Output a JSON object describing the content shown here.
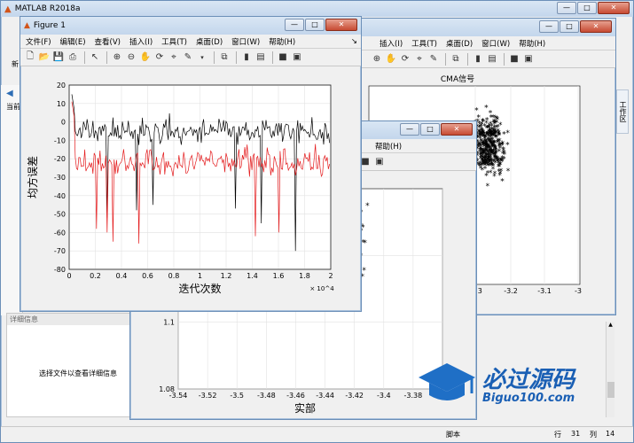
{
  "app": {
    "title": "MATLAB R2018a",
    "toolstrip_new": "新",
    "left_label_current": "当前",
    "right_tab_label": "工作区",
    "detail_header": "详细信息",
    "detail_placeholder": "选择文件以查看详细信息",
    "status_script": "脚本",
    "status_row_label": "行",
    "status_row": "31",
    "status_col_label": "列",
    "status_col": "14"
  },
  "figure1": {
    "title": "Figure 1",
    "menu": [
      "文件(F)",
      "编辑(E)",
      "查看(V)",
      "插入(I)",
      "工具(T)",
      "桌面(D)",
      "窗口(W)",
      "帮助(H)"
    ],
    "controls": {
      "min": "—",
      "max": "□",
      "close": "✕"
    }
  },
  "figure_cma": {
    "menu": [
      "插入(I)",
      "工具(T)",
      "桌面(D)",
      "窗口(W)",
      "帮助(H)"
    ]
  },
  "figure_mid": {
    "menu_help": "帮助(H)"
  },
  "watermark": {
    "name": "必过源码",
    "url": "Biguo100.com"
  },
  "colors": {
    "series_black": "#000000",
    "series_red": "#e41a1c",
    "title_bg": "#c3d6ec"
  },
  "chart_data": [
    {
      "type": "line",
      "xlabel": "迭代次数",
      "ylabel": "均方误差",
      "x_exponent": "× 10^4",
      "xlim": [
        0,
        2
      ],
      "ylim": [
        -80,
        20
      ],
      "xticks": [
        "0",
        "0.2",
        "0.4",
        "0.6",
        "0.8",
        "1",
        "1.2",
        "1.4",
        "1.6",
        "1.8",
        "2"
      ],
      "yticks": [
        "20",
        "10",
        "0",
        "-10",
        "-20",
        "-30",
        "-40",
        "-50",
        "-60",
        "-70",
        "-80"
      ],
      "grid": true,
      "series": [
        {
          "color": "#000000",
          "mean": -5,
          "spread": 10,
          "spikes": [
            -47,
            -70,
            -45,
            -52,
            -48,
            -55
          ]
        },
        {
          "color": "#e41a1c",
          "mean": -22,
          "spread": 12,
          "spikes": [
            -65,
            -60,
            -62,
            -58,
            -66,
            -60
          ]
        }
      ]
    },
    {
      "type": "scatter",
      "title": "CMA信号",
      "xticks": [
        "-3.3",
        "-3.2",
        "-3.1",
        "-3"
      ],
      "marker": "*",
      "grid": true
    },
    {
      "type": "scatter",
      "xlabel": "实部",
      "xticks": [
        "-3.54",
        "-3.52",
        "-3.5",
        "-3.48",
        "-3.46",
        "-3.44",
        "-3.42",
        "-3.4",
        "-3.38",
        "-3.36"
      ],
      "yticks": [
        "1.12",
        "1.1",
        "1.08"
      ],
      "xlim": [
        -3.54,
        -3.36
      ],
      "ylim": [
        1.08,
        1.14
      ],
      "marker": "*",
      "grid": true
    }
  ]
}
